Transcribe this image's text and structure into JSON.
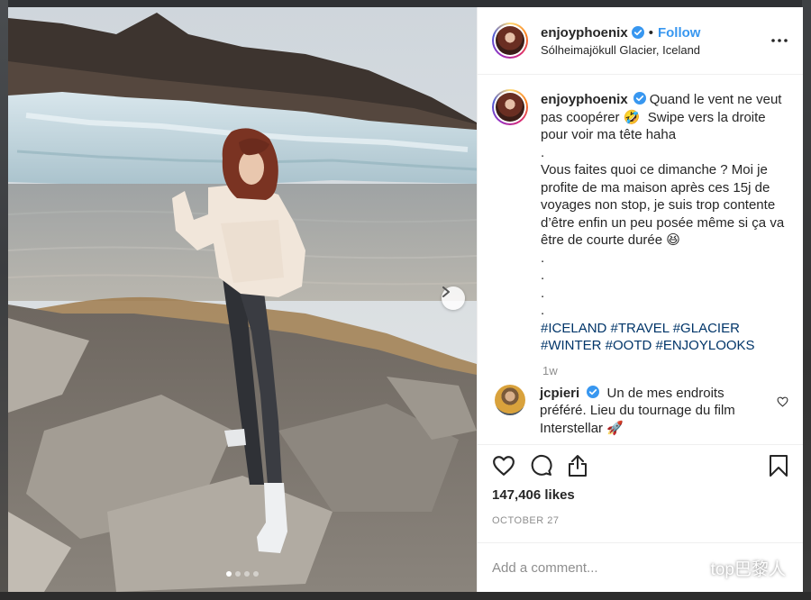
{
  "post": {
    "username": "enjoyphoenix",
    "separator": "•",
    "follow_label": "Follow",
    "location": "Sólheimajökull Glacier, Iceland",
    "caption_text": "Quand le vent ne veut pas coopérer 🤣  Swipe vers la droite pour voir ma tête haha\n.\nVous faites quoi ce dimanche ? Moi je profite de ma maison après ces 15j de voyages non stop, je suis trop contente d’être enfin un peu posée même si ça va être de courte durée 😆\n.\n.\n.\n.",
    "hashtags": "#ICELAND #TRAVEL #GLACIER #WINTER #OOTD #ENJOYLOOKS",
    "time_ago": "1w",
    "likes": "147,406 likes",
    "date": "OCTOBER 27",
    "add_comment_placeholder": "Add a comment...",
    "carousel": {
      "slide_count": 4,
      "active_index": 0
    }
  },
  "comment": {
    "username": "jcpieri",
    "text": "Un de mes endroits préféré. Lieu du tournage du film Interstellar 🚀"
  },
  "watermark": {
    "text": "top巴黎人"
  },
  "icons": {
    "verified": "verified-badge-icon",
    "more": "more-options-icon",
    "like": "heart-icon",
    "comment": "comment-bubble-icon",
    "share": "share-icon",
    "save": "bookmark-icon",
    "next": "chevron-right-icon",
    "watermark": "wechat-icon"
  },
  "colors": {
    "link_blue": "#3897f0",
    "hashtag": "#003569",
    "verified": "#3897f0",
    "muted": "#8e8e8e",
    "text": "#262626"
  }
}
